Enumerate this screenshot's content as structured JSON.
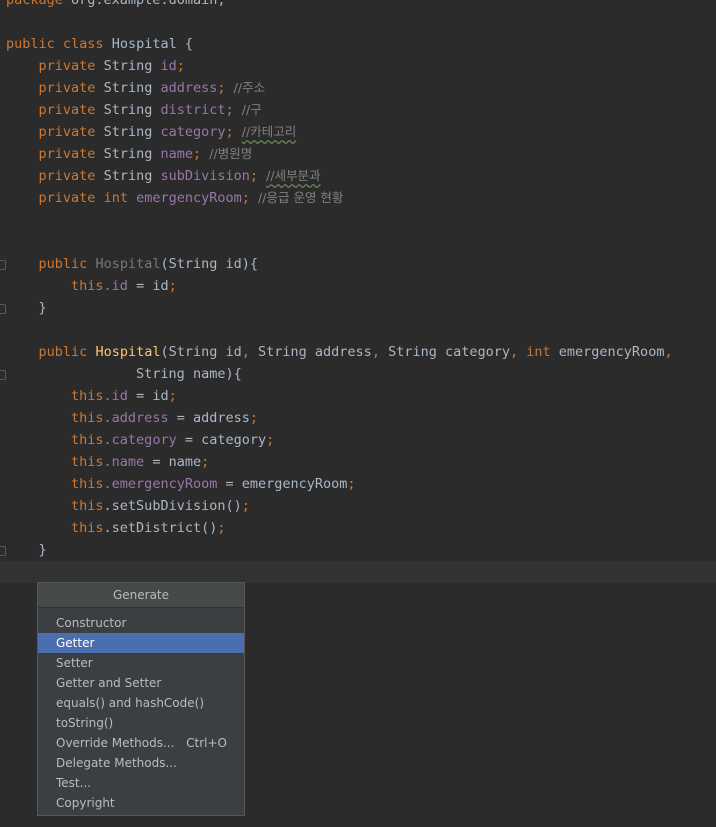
{
  "code": {
    "line0": {
      "kw": "package",
      "rest": " org.example.domain;"
    },
    "line1": {
      "kw1": "public",
      "kw2": "class",
      "name": "Hospital",
      "brace": "{"
    },
    "fields": [
      {
        "kw": "private",
        "type": "String",
        "name": "id",
        "semi": ";",
        "comment": ""
      },
      {
        "kw": "private",
        "type": "String",
        "name": "address",
        "semi": ";",
        "comment": "//주소"
      },
      {
        "kw": "private",
        "type": "String",
        "name": "district",
        "semi": ";",
        "comment": "//구"
      },
      {
        "kw": "private",
        "type": "String",
        "name": "category",
        "semi": ";",
        "comment": "//카테고리"
      },
      {
        "kw": "private",
        "type": "String",
        "name": "name",
        "semi": ";",
        "comment": "//병원명"
      },
      {
        "kw": "private",
        "type": "String",
        "name": "subDivision",
        "semi": ";",
        "comment": "//세부분과"
      },
      {
        "kw": "private",
        "type": "int",
        "name": "emergencyRoom",
        "semi": ";",
        "comment": "//응급 운영 현황"
      }
    ],
    "ctor1": {
      "kw": "public",
      "name": "Hospital",
      "params": "(String id){",
      "body_this": "this",
      "body_field": ".id",
      "body_rest": " = id",
      "body_semi": ";",
      "close": "}"
    },
    "ctor2": {
      "kw": "public",
      "name": "Hospital",
      "p1": "(String id",
      "c1": ",",
      "p2": " String address",
      "c2": ",",
      "p3": " String category",
      "c3": ",",
      "int_kw": " int",
      "p4": " emergencyRoom",
      "c4": ",",
      "cont": "String name){",
      "assigns": [
        {
          "this": "this",
          "field": ".id",
          "rest": " = id",
          "semi": ";"
        },
        {
          "this": "this",
          "field": ".address",
          "rest": " = address",
          "semi": ";"
        },
        {
          "this": "this",
          "field": ".category",
          "rest": " = category",
          "semi": ";"
        },
        {
          "this": "this",
          "field": ".name",
          "rest": " = name",
          "semi": ";"
        },
        {
          "this": "this",
          "field": ".emergencyRoom",
          "rest": " = emergencyRoom",
          "semi": ";"
        },
        {
          "this": "this",
          "field": "",
          "rest": ".setSubDivision()",
          "semi": ";"
        },
        {
          "this": "this",
          "field": "",
          "rest": ".setDistrict()",
          "semi": ";"
        }
      ],
      "close": "}"
    }
  },
  "popup": {
    "title": "Generate",
    "items": [
      {
        "label": "Constructor",
        "shortcut": ""
      },
      {
        "label": "Getter",
        "shortcut": ""
      },
      {
        "label": "Setter",
        "shortcut": ""
      },
      {
        "label": "Getter and Setter",
        "shortcut": ""
      },
      {
        "label": "equals() and hashCode()",
        "shortcut": ""
      },
      {
        "label": "toString()",
        "shortcut": ""
      },
      {
        "label": "Override Methods...",
        "shortcut": "Ctrl+O"
      },
      {
        "label": "Delegate Methods...",
        "shortcut": ""
      },
      {
        "label": "Test...",
        "shortcut": ""
      },
      {
        "label": "Copyright",
        "shortcut": ""
      }
    ],
    "selected_item": "Getter"
  },
  "colors": {
    "background": "#2b2b2b",
    "keyword": "#cc7832",
    "field": "#9876aa",
    "comment": "#808080",
    "method": "#ffc66d",
    "text": "#a9b7c6",
    "selection": "#4b6eaf"
  }
}
